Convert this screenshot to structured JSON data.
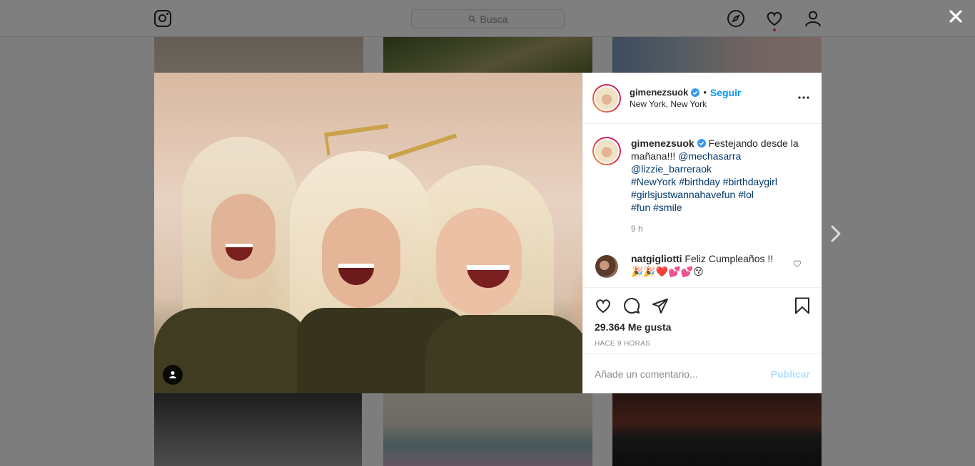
{
  "nav": {
    "search_placeholder": "Busca",
    "icons": [
      "instagram-logo",
      "compass-icon",
      "heart-icon",
      "profile-icon"
    ]
  },
  "post": {
    "username": "gimenezsuok",
    "separator": "•",
    "follow_label": "Seguir",
    "location": "New York, New York",
    "caption": {
      "username": "gimenezsuok",
      "text": " Festejando desde la mañana!!! ",
      "mentions": [
        "@mechasarra",
        "@lizzie_barreraok"
      ],
      "hashtags": [
        "#NewYork",
        "#birthday",
        "#birthdaygirl",
        "#girlsjustwannahavefun",
        "#lol",
        "#fun",
        "#smile"
      ],
      "time": "9 h"
    },
    "reply": {
      "username": "natgigliotti",
      "text": " Feliz Cumpleaños !!🎉🎉❤️💕💕😚"
    },
    "likes": "29.364 Me gusta",
    "posted": "HACE 9 HORAS",
    "comment_placeholder": "Añade un comentario...",
    "publish_label": "Publicar"
  },
  "colors": {
    "accent": "#0095f6",
    "tag": "#00376b",
    "publish_disabled": "#b2dffc",
    "notification_dot": "#ed4956"
  }
}
